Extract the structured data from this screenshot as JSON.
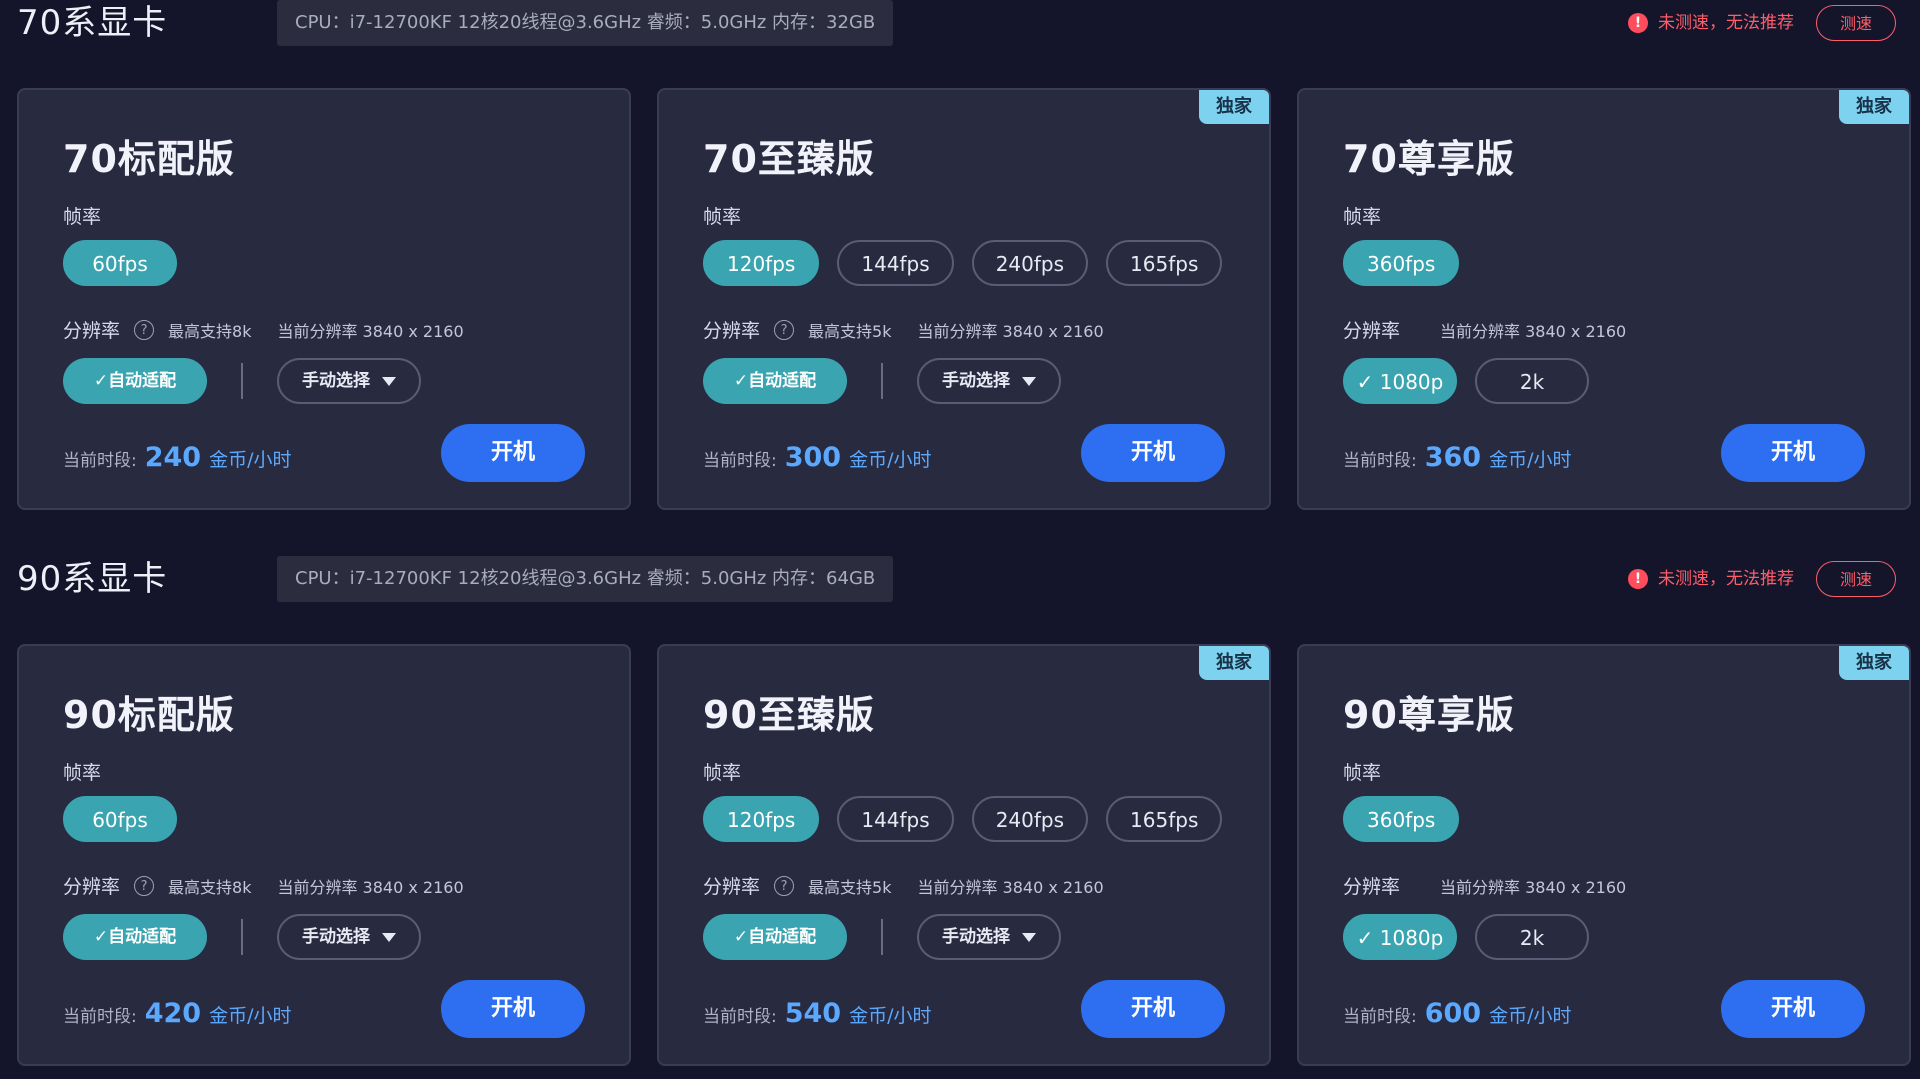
{
  "sections": [
    {
      "title": "70系显卡",
      "cpu_info": "CPU：i7-12700KF 12核20线程@3.6GHz 睿频：5.0GHz 内存：32GB",
      "warning": "未测速，无法推荐",
      "speed_test_label": "测速",
      "cards": [
        {
          "title": "70标配版",
          "fps_label": "帧率",
          "fps_options": [
            "60fps"
          ],
          "res_label": "分辨率",
          "max_support": "最高支持8k",
          "current_res": "当前分辨率 3840 x 2160",
          "auto_label": "✓自动适配",
          "manual_label": "手动选择",
          "price_prefix": "当前时段:",
          "price": "240",
          "price_unit": "金币/小时",
          "start_label": "开机"
        },
        {
          "badge": "独家",
          "title": "70至臻版",
          "fps_label": "帧率",
          "fps_options": [
            "120fps",
            "144fps",
            "240fps",
            "165fps"
          ],
          "res_label": "分辨率",
          "max_support": "最高支持5k",
          "current_res": "当前分辨率 3840 x 2160",
          "auto_label": "✓自动适配",
          "manual_label": "手动选择",
          "price_prefix": "当前时段:",
          "price": "300",
          "price_unit": "金币/小时",
          "start_label": "开机"
        },
        {
          "badge": "独家",
          "title": "70尊享版",
          "fps_label": "帧率",
          "fps_options": [
            "360fps"
          ],
          "res_label": "分辨率",
          "current_res": "当前分辨率 3840 x 2160",
          "res_options": [
            "✓ 1080p",
            "2k"
          ],
          "price_prefix": "当前时段:",
          "price": "360",
          "price_unit": "金币/小时",
          "start_label": "开机"
        }
      ]
    },
    {
      "title": "90系显卡",
      "cpu_info": "CPU：i7-12700KF 12核20线程@3.6GHz 睿频：5.0GHz 内存：64GB",
      "warning": "未测速，无法推荐",
      "speed_test_label": "测速",
      "cards": [
        {
          "title": "90标配版",
          "fps_label": "帧率",
          "fps_options": [
            "60fps"
          ],
          "res_label": "分辨率",
          "max_support": "最高支持8k",
          "current_res": "当前分辨率 3840 x 2160",
          "auto_label": "✓自动适配",
          "manual_label": "手动选择",
          "price_prefix": "当前时段:",
          "price": "420",
          "price_unit": "金币/小时",
          "start_label": "开机"
        },
        {
          "badge": "独家",
          "title": "90至臻版",
          "fps_label": "帧率",
          "fps_options": [
            "120fps",
            "144fps",
            "240fps",
            "165fps"
          ],
          "res_label": "分辨率",
          "max_support": "最高支持5k",
          "current_res": "当前分辨率 3840 x 2160",
          "auto_label": "✓自动适配",
          "manual_label": "手动选择",
          "price_prefix": "当前时段:",
          "price": "540",
          "price_unit": "金币/小时",
          "start_label": "开机"
        },
        {
          "badge": "独家",
          "title": "90尊享版",
          "fps_label": "帧率",
          "fps_options": [
            "360fps"
          ],
          "res_label": "分辨率",
          "current_res": "当前分辨率 3840 x 2160",
          "res_options": [
            "✓ 1080p",
            "2k"
          ],
          "price_prefix": "当前时段:",
          "price": "600",
          "price_unit": "金币/小时",
          "start_label": "开机"
        }
      ]
    }
  ],
  "colors": {
    "accent_teal": "#3aa5b0",
    "accent_blue": "#2e6ff2",
    "warning_red": "#ff5d6a",
    "badge": "#7dd3ef"
  }
}
